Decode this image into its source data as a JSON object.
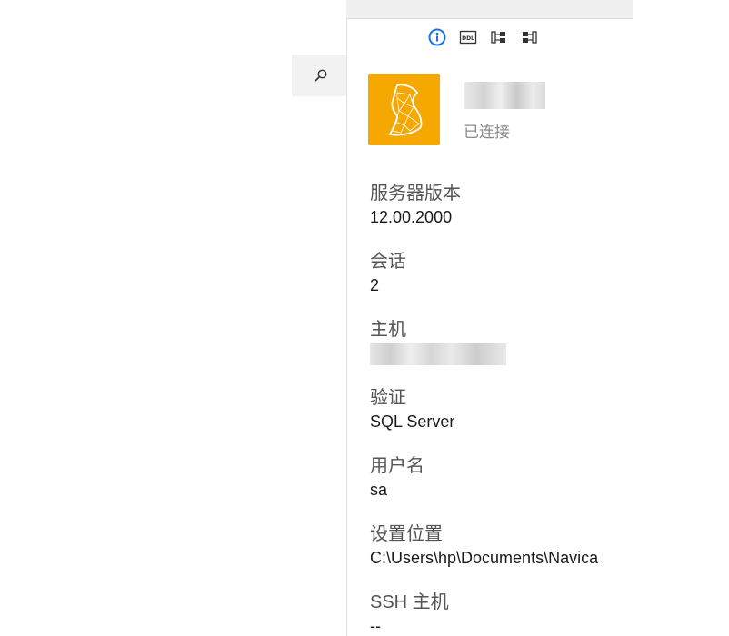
{
  "search": {
    "icon": "search-icon"
  },
  "toolbar": {
    "buttons": [
      {
        "icon": "info-icon",
        "color": "#1a73e8"
      },
      {
        "icon": "ddl-icon",
        "label": "DDL"
      },
      {
        "icon": "er-diagram-icon"
      },
      {
        "icon": "schema-icon"
      }
    ]
  },
  "connection": {
    "logo_color": "#f5a800",
    "status": "已连接"
  },
  "fields": [
    {
      "label": "服务器版本",
      "value": "12.00.2000"
    },
    {
      "label": "会话",
      "value": "2"
    },
    {
      "label": "主机",
      "value": ""
    },
    {
      "label": "验证",
      "value": "SQL Server"
    },
    {
      "label": "用户名",
      "value": "sa"
    },
    {
      "label": "设置位置",
      "value": "C:\\Users\\hp\\Documents\\Navica"
    },
    {
      "label": "SSH 主机",
      "value": "--"
    }
  ]
}
